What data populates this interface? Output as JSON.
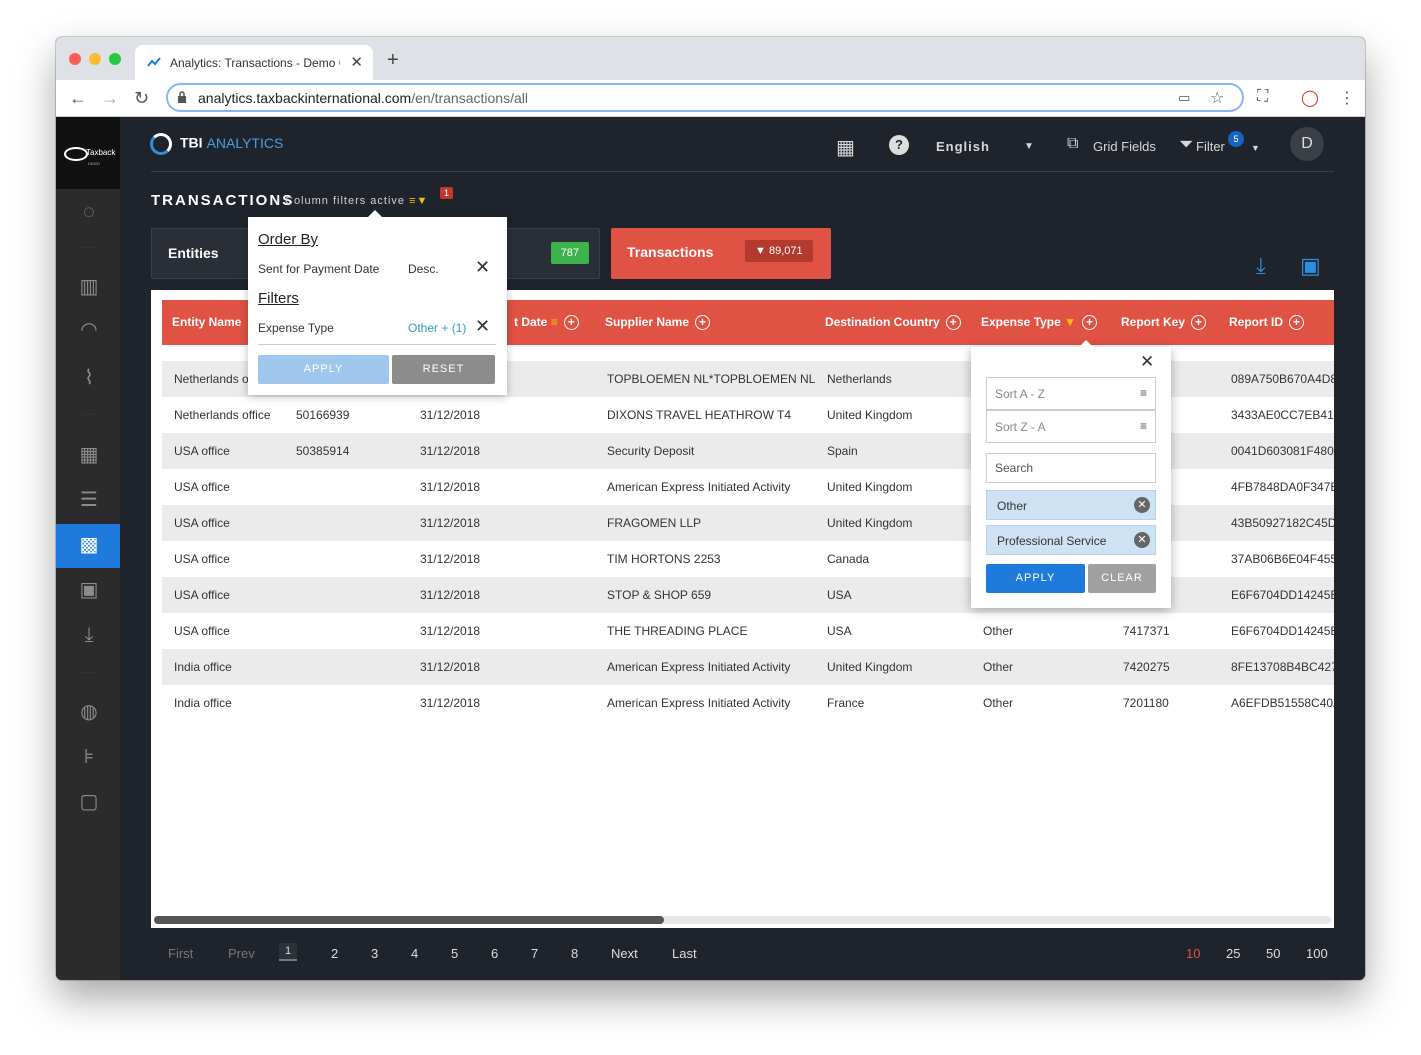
{
  "browser": {
    "tab_title": "Analytics: Transactions - Demo C",
    "url_domain": "analytics.taxbackinternational.com",
    "url_path": "/en/transactions/all"
  },
  "header": {
    "brand_tbi": "TBI",
    "brand_analytics": "ANALYTICS",
    "language": "English",
    "grid_fields": "Grid Fields",
    "filter": "Filter",
    "filter_count": "5",
    "avatar": "D"
  },
  "page": {
    "title": "TRANSACTIONS",
    "column_filters_text": "Column filters active",
    "column_filters_count": "1"
  },
  "cards": {
    "entities_label": "Entities",
    "entities_count": "787",
    "transactions_label": "Transactions",
    "transactions_count": "89,071"
  },
  "table": {
    "columns": [
      "Entity Name",
      "t Date",
      "Supplier Name",
      "Destination Country",
      "Expense Type",
      "Report Key",
      "Report ID"
    ],
    "rows": [
      [
        "Netherlands o",
        "",
        "",
        "TOPBLOEMEN NL*TOPBLOEMEN NL",
        "Netherlands",
        "",
        "",
        "089A750B670A4D8"
      ],
      [
        "Netherlands office",
        "50166939",
        "31/12/2018",
        "DIXONS TRAVEL HEATHROW T4",
        "United Kingdom",
        "",
        "",
        "3433AE0CC7EB410"
      ],
      [
        "USA office",
        "50385914",
        "31/12/2018",
        "Security Deposit",
        "Spain",
        "",
        "",
        "0041D603081F480"
      ],
      [
        "USA office",
        "",
        "31/12/2018",
        "American Express Initiated Activity",
        "United Kingdom",
        "",
        "",
        "4FB7848DA0F347E"
      ],
      [
        "USA office",
        "",
        "31/12/2018",
        "FRAGOMEN LLP",
        "United Kingdom",
        "",
        "",
        "43B50927182C45D"
      ],
      [
        "USA office",
        "",
        "31/12/2018",
        "TIM HORTONS 2253",
        "Canada",
        "",
        "",
        "37AB06B6E04F455"
      ],
      [
        "USA office",
        "",
        "31/12/2018",
        "STOP & SHOP 659",
        "USA",
        "",
        "",
        "E6F6704DD14245E"
      ],
      [
        "USA office",
        "",
        "31/12/2018",
        "THE THREADING PLACE",
        "USA",
        "Other",
        "7417371",
        "E6F6704DD14245E"
      ],
      [
        "India office",
        "",
        "31/12/2018",
        "American Express Initiated Activity",
        "United Kingdom",
        "Other",
        "7420275",
        "8FE13708B4BC427"
      ],
      [
        "India office",
        "",
        "31/12/2018",
        "American Express Initiated Activity",
        "France",
        "Other",
        "7201180",
        "A6EFDB51558C40A"
      ]
    ]
  },
  "pagination": {
    "first": "First",
    "prev": "Prev",
    "pages": [
      "1",
      "2",
      "3",
      "4",
      "5",
      "6",
      "7",
      "8"
    ],
    "next": "Next",
    "last": "Last",
    "sizes": [
      "10",
      "25",
      "50",
      "100"
    ]
  },
  "order_popup": {
    "order_by": "Order By",
    "order_field": "Sent for Payment Date",
    "order_dir": "Desc.",
    "filters": "Filters",
    "filter_field": "Expense Type",
    "filter_value": "Other + (1)",
    "apply": "APPLY",
    "reset": "RESET"
  },
  "column_popup": {
    "sort_az": "Sort A - Z",
    "sort_za": "Sort Z - A",
    "search_placeholder": "Search",
    "chips": [
      "Other",
      "Professional Service"
    ],
    "apply": "APPLY",
    "clear": "CLEAR"
  },
  "colors": {
    "accent_red": "#e05244",
    "accent_blue": "#1e7bdb",
    "count_green": "#3cb44b",
    "filter_yellow": "#f2c200"
  }
}
